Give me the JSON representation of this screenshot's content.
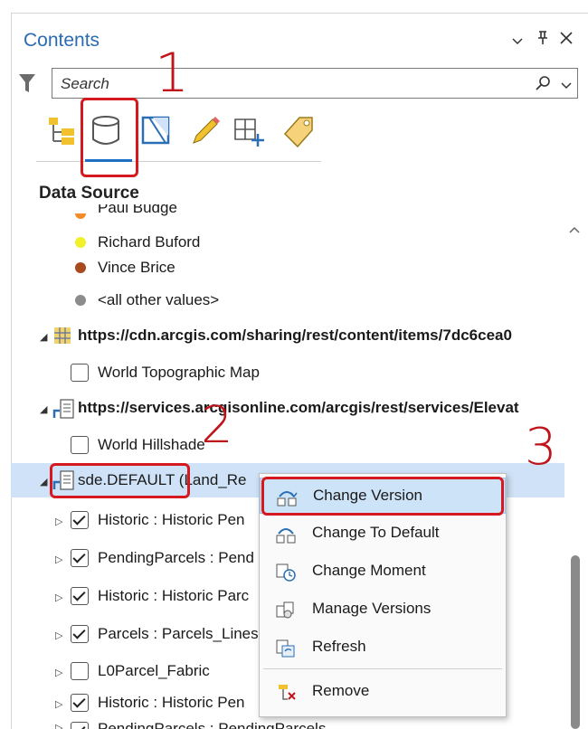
{
  "pane": {
    "title": "Contents",
    "controls": {
      "dropdown": "⌄",
      "pin": "⫯",
      "close": "✕"
    }
  },
  "search": {
    "placeholder": "Search",
    "value": ""
  },
  "toolbar": {
    "icons": [
      "list-by-drawing-order-icon",
      "list-by-data-source-icon",
      "list-by-selection-icon",
      "list-by-editing-icon",
      "list-by-snapping-icon",
      "list-by-labeling-icon"
    ],
    "active_index": 1
  },
  "section_title": "Data Source",
  "legend_items": [
    {
      "label": "Paul Budge",
      "color": "#f28c28"
    },
    {
      "label": "Richard Buford",
      "color": "#f2ef2b"
    },
    {
      "label": "Vince Brice",
      "color": "#a84a1e"
    },
    {
      "label": "<all other values>",
      "color": "#8c8c8c"
    }
  ],
  "sources": [
    {
      "label": "https://cdn.arcgis.com/sharing/rest/content/items/7dc6cea0",
      "icon": "tile-service-icon",
      "children": [
        {
          "label": "World Topographic Map",
          "checked": false
        }
      ]
    },
    {
      "label": "https://services.arcgisonline.com/arcgis/rest/services/Elevat",
      "icon": "map-service-icon",
      "children": [
        {
          "label": "World Hillshade",
          "checked": false
        }
      ]
    },
    {
      "label": "sde.DEFAULT (Land_Re",
      "icon": "enterprise-geodatabase-icon",
      "selected": true
    }
  ],
  "layers": [
    {
      "label": "Historic : Historic Pen",
      "checked": true
    },
    {
      "label": "PendingParcels : Pend",
      "checked": true
    },
    {
      "label": "Historic : Historic Parc",
      "checked": true
    },
    {
      "label": "Parcels : Parcels_Lines",
      "checked": true
    },
    {
      "label": "L0Parcel_Fabric",
      "checked": false
    },
    {
      "label": "Historic : Historic Pen",
      "checked": true
    },
    {
      "label": "PendingParcels : PendingParcels",
      "checked": true
    }
  ],
  "context_menu": {
    "items": [
      {
        "label": "Change Version",
        "icon": "change-version-icon",
        "highlighted": true
      },
      {
        "label": "Change To Default",
        "icon": "change-to-default-icon"
      },
      {
        "label": "Change Moment",
        "icon": "change-moment-icon"
      },
      {
        "label": "Manage Versions",
        "icon": "manage-versions-icon"
      },
      {
        "label": "Refresh",
        "icon": "refresh-icon"
      },
      {
        "label": "Remove",
        "icon": "remove-icon"
      }
    ]
  },
  "annotations": {
    "step1": "1",
    "step2": "2",
    "step3": "3",
    "color": "#d6191f"
  }
}
